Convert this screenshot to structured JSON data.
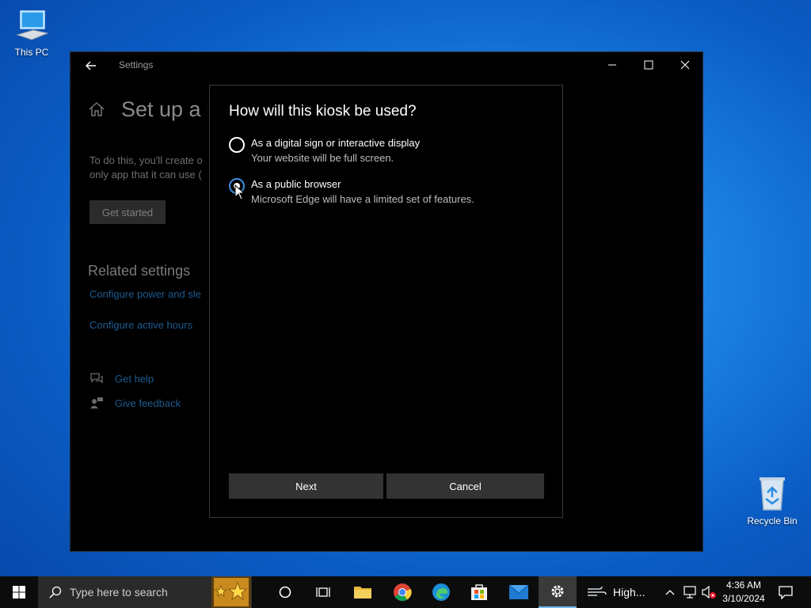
{
  "desktop": {
    "this_pc_label": "This PC",
    "recycle_bin_label": "Recycle Bin"
  },
  "settings_window": {
    "title": "Settings",
    "page_title": "Set up a kiosk",
    "description_line1": "To do this, you'll create o",
    "description_line2": "only app that it can use (",
    "get_started_label": "Get started",
    "related_heading": "Related settings",
    "link_power": "Configure power and sle",
    "link_active_hours": "Configure active hours",
    "get_help": "Get help",
    "give_feedback": "Give feedback"
  },
  "dialog": {
    "title": "How will this kiosk be used?",
    "options": [
      {
        "label": "As a digital sign or interactive display",
        "sub": "Your website will be full screen.",
        "checked": false
      },
      {
        "label": "As a public browser",
        "sub": "Microsoft Edge will have a limited set of features.",
        "checked": true
      }
    ],
    "next_label": "Next",
    "cancel_label": "Cancel"
  },
  "taskbar": {
    "search_placeholder": "Type here to search",
    "weather_text": "High...",
    "time": "4:36 AM",
    "date": "3/10/2024"
  },
  "colors": {
    "accent": "#3b8de0",
    "link": "#1d5a8f"
  }
}
